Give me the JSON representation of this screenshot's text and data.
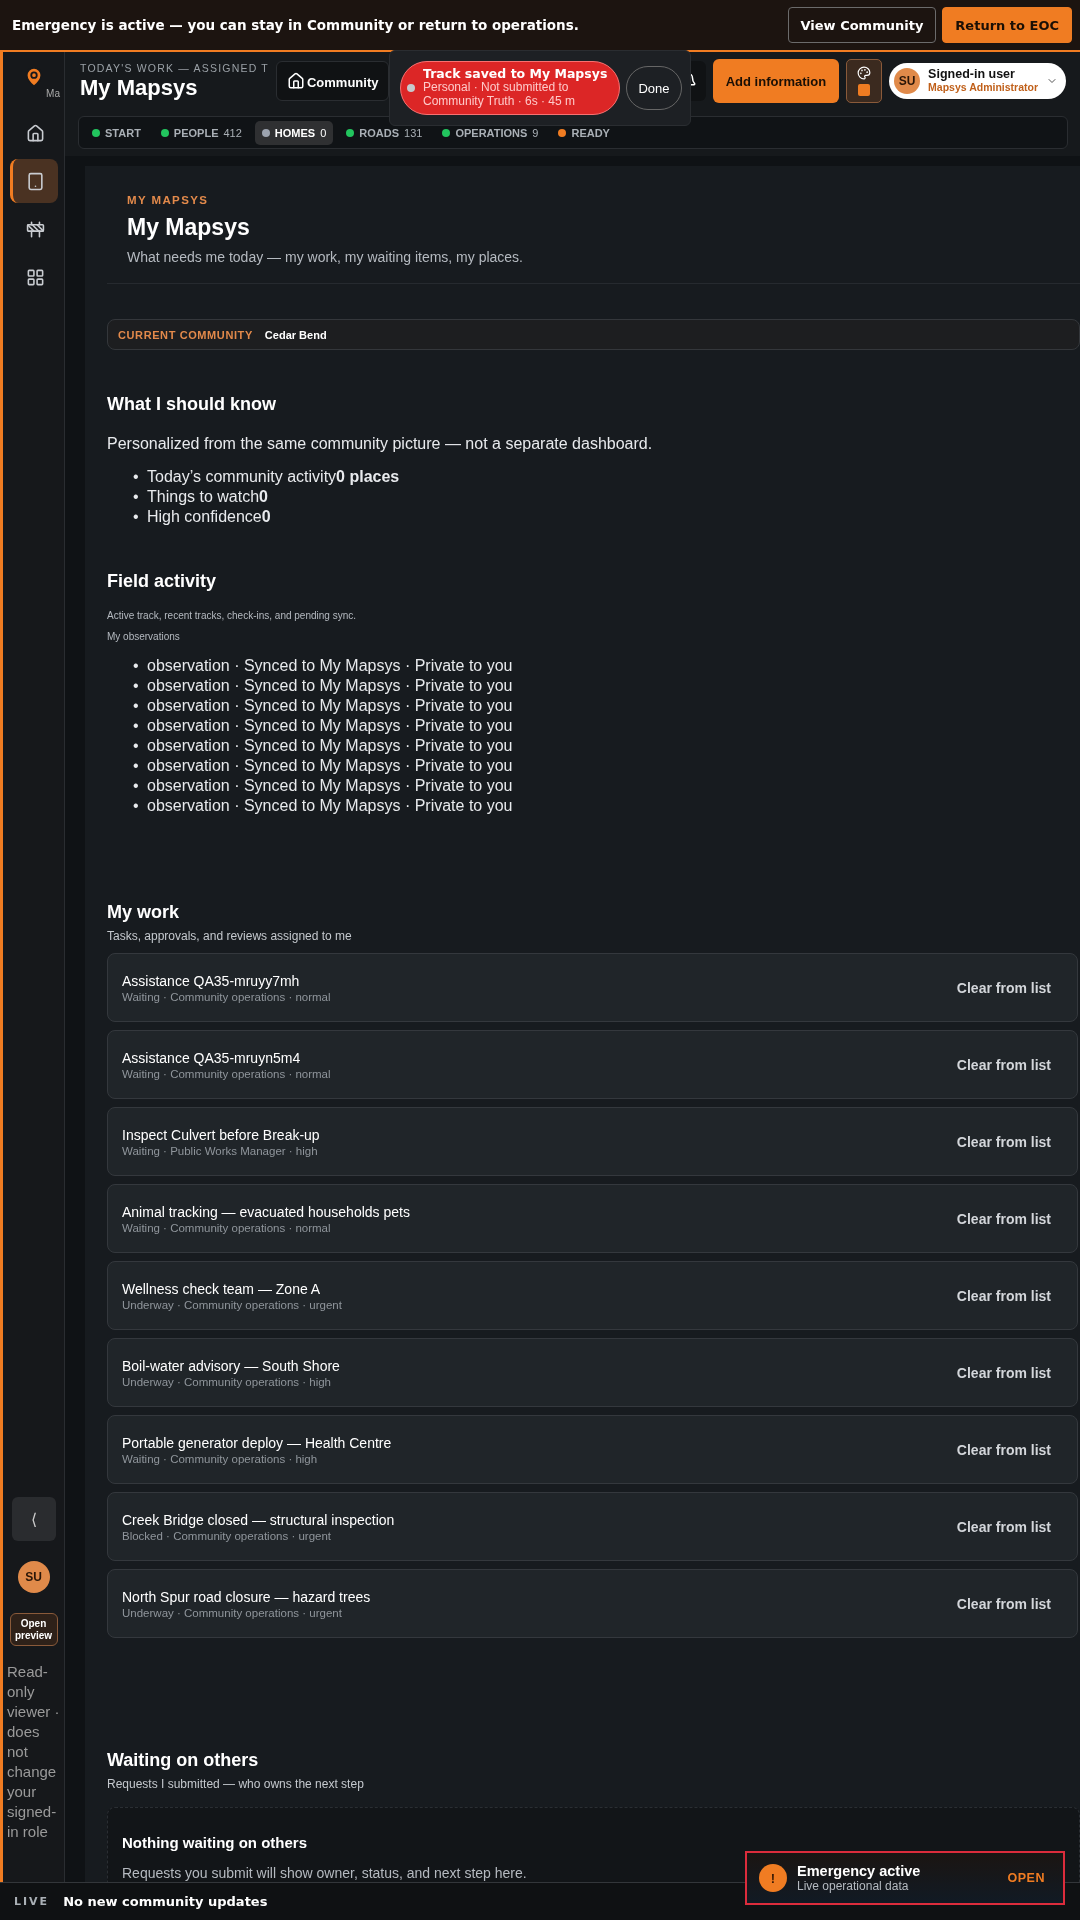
{
  "banner": {
    "message": "Emergency is active — you can stay in Community or return to operations.",
    "buttons": [
      {
        "label": "View Community",
        "kind": "secondary"
      },
      {
        "label": "Return to EOC",
        "kind": "primary"
      }
    ]
  },
  "sidebar": {
    "brand": "Ma",
    "items": [
      {
        "selected": false
      },
      {
        "selected": true
      },
      {
        "selected": false
      },
      {
        "selected": false
      }
    ],
    "collapse": "⟨",
    "avatar": "SU",
    "preview_button": "Open preview",
    "note": "Read-only viewer · does not change your signed-in role"
  },
  "header": {
    "eyebrow": "TODAY'S WORK — ASSIGNED T",
    "title": "My Mapsys",
    "community_button": "Community",
    "add_button": "Add information",
    "user": {
      "initials": "SU",
      "name": "Signed-in user",
      "role": "Mapsys Administrator"
    }
  },
  "track_toast": {
    "title": "Track saved to My Mapsys",
    "detail": "Personal · Not submitted to Community Truth · 6s · 45 m",
    "done": "Done"
  },
  "chips": [
    {
      "label": "START",
      "color": "#22c55e",
      "selected": false
    },
    {
      "label": "PEOPLE",
      "count": "412",
      "color": "#22c55e",
      "selected": false
    },
    {
      "label": "HOMES",
      "count": "0",
      "color": "#9ca3af",
      "selected": true
    },
    {
      "label": "ROADS",
      "count": "131",
      "color": "#22c55e",
      "selected": false
    },
    {
      "label": "OPERATIONS",
      "count": "9",
      "color": "#22c55e",
      "selected": false
    },
    {
      "label": "READY",
      "color": "#f07c22",
      "selected": false
    }
  ],
  "page": {
    "eyebrow": "MY MAPSYS",
    "title": "My Mapsys",
    "subtitle": "What needs me today — my work, my waiting items, my places.",
    "community_label": "CURRENT COMMUNITY",
    "community_name": "Cedar Bend"
  },
  "know": {
    "title": "What I should know",
    "intro": "Personalized from the same community picture — not a separate dashboard.",
    "items": [
      {
        "marker": "•",
        "text": "Today’s community activity**0 places**"
      },
      {
        "marker": "•",
        "text": "Things to watch**0**"
      },
      {
        "marker": "•",
        "text": "High confidence**0**"
      }
    ]
  },
  "field": {
    "title": "Field activity",
    "intro": "Active track, recent tracks, check-ins, and pending sync.",
    "label": "My observations",
    "items": [
      {
        "marker": "•",
        "text": "observation · Synced to My Mapsys · Private to you"
      },
      {
        "marker": "•",
        "text": "observation · Synced to My Mapsys · Private to you"
      },
      {
        "marker": "•",
        "text": "observation · Synced to My Mapsys · Private to you"
      },
      {
        "marker": "•",
        "text": "observation · Synced to My Mapsys · Private to you"
      },
      {
        "marker": "•",
        "text": "observation · Synced to My Mapsys · Private to you"
      },
      {
        "marker": "•",
        "text": "observation · Synced to My Mapsys · Private to you"
      },
      {
        "marker": "•",
        "text": "observation · Synced to My Mapsys · Private to you"
      },
      {
        "marker": "•",
        "text": "observation · Synced to My Mapsys · Private to you"
      }
    ]
  },
  "work": {
    "title": "My work",
    "intro": "Tasks, approvals, and reviews assigned to me",
    "rows": [
      {
        "title": "Assistance QA35-mruyy7mh",
        "meta": "Waiting · Community operations · normal",
        "action": "Clear from list"
      },
      {
        "title": "Assistance QA35-mruyn5m4",
        "meta": "Waiting · Community operations · normal",
        "action": "Clear from list"
      },
      {
        "title": "Inspect Culvert before Break-up",
        "meta": "Waiting · Public Works Manager · high",
        "action": "Clear from list"
      },
      {
        "title": "Animal tracking — evacuated households pets",
        "meta": "Waiting · Community operations · normal",
        "action": "Clear from list"
      },
      {
        "title": "Wellness check team — Zone A",
        "meta": "Underway · Community operations · urgent",
        "action": "Clear from list"
      },
      {
        "title": "Boil-water advisory — South Shore",
        "meta": "Underway · Community operations · high",
        "action": "Clear from list"
      },
      {
        "title": "Portable generator deploy — Health Centre",
        "meta": "Waiting · Community operations · high",
        "action": "Clear from list"
      },
      {
        "title": "Creek Bridge closed — structural inspection",
        "meta": "Blocked · Community operations · urgent",
        "action": "Clear from list"
      },
      {
        "title": "North Spur road closure — hazard trees",
        "meta": "Underway · Community operations · urgent",
        "action": "Clear from list"
      }
    ]
  },
  "waiting": {
    "title": "Waiting on others",
    "intro": "Requests I submitted — who owns the next step",
    "empty_title": "Nothing waiting on others",
    "empty_text": "Requests you submit will show owner, status, and next step here."
  },
  "status_bar": {
    "live": "LIVE",
    "message": "No new community updates"
  },
  "emergency_toast": {
    "mark": "!",
    "title": "Emergency active",
    "subtitle": "Live operational data",
    "action": "OPEN"
  }
}
